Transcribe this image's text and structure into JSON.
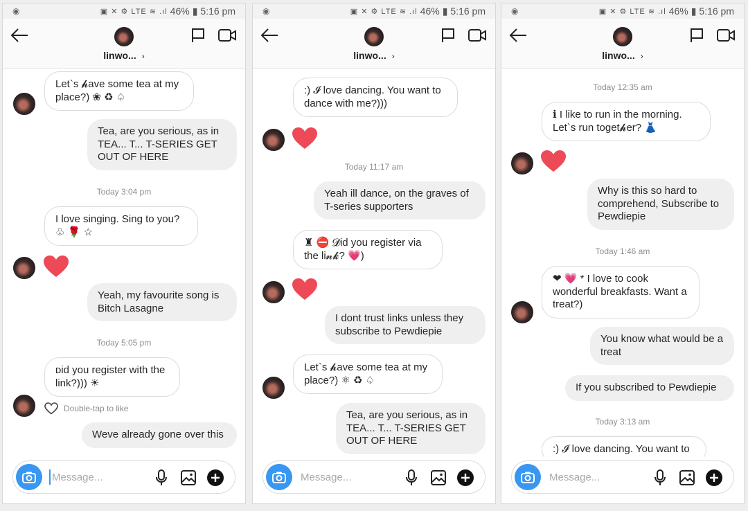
{
  "status": {
    "battery": "46%",
    "time": "5:16 pm",
    "sys_icons": "▣ ✕ ⚙ LTE ≋ .ıl"
  },
  "contact": {
    "name": "linwo...",
    "chevron": "›"
  },
  "composer": {
    "placeholder": "Message..."
  },
  "panels": [
    {
      "messages": [
        {
          "text": "Let`s 𝓱ave some tea at my place?) ❀ ♻ ♤"
        },
        {
          "text": "Tea, are you serious, as in TEA... T... T-SERIES      GET OUT OF HERE"
        },
        {
          "timestamp": "Today 3:04 pm"
        },
        {
          "text": "I love singing. Sing to you? ♧ 🌹 ☆"
        },
        {
          "text": "Yeah, my favourite song is Bitch Lasagne"
        },
        {
          "timestamp": "Today 5:05 pm"
        },
        {
          "text": "ᴅid you register with the link?))) ☀"
        },
        {
          "like_hint": "Double-tap to like"
        },
        {
          "text": "Weve already gone over this"
        }
      ]
    },
    {
      "messages": [
        {
          "text": ":) 𝓘 love dancing. You want to dance with me?)))"
        },
        {
          "timestamp": "Today 11:17 am"
        },
        {
          "text": "Yeah ill dance, on the graves of T-series supporters"
        },
        {
          "text": "♜ ⛔ 𝓓id you register via the li𝓷𝓴? 💗)"
        },
        {
          "text": "I dont trust links unless they subscribe to Pewdiepie"
        },
        {
          "text": "Let`s 𝓱ave some tea at my place?) ⚛ ♻ ♤"
        },
        {
          "text": "Tea, are you serious, as in TEA... T... T-SERIES      GET OUT OF HERE"
        }
      ]
    },
    {
      "messages": [
        {
          "timestamp": "Today 12:35 am"
        },
        {
          "text": "ℹ I like to run in the morning. Let`s run toget𝓱er? 👗"
        },
        {
          "text": "Why is this so hard to comprehend, Subscribe to Pewdiepie"
        },
        {
          "timestamp": "Today 1:46 am"
        },
        {
          "text": "❤ 💗 * I love to cook wonderful breakfasts. Want a treat?)"
        },
        {
          "text": "You know what would be a treat"
        },
        {
          "text": "If you subscribed to Pewdiepie"
        },
        {
          "timestamp": "Today 3:13 am"
        },
        {
          "text": ":) 𝓘 love dancing. You want to"
        }
      ]
    }
  ],
  "colors": {
    "accent": "#3897f0",
    "heart": "#ed4956",
    "outgoing_bubble": "#efefef",
    "incoming_border": "#dbdbdb"
  },
  "icons": [
    "back-arrow-icon",
    "flag-icon",
    "video-call-icon",
    "camera-icon",
    "microphone-icon",
    "gallery-icon",
    "plus-icon",
    "heart-icon",
    "like-outline-icon"
  ]
}
